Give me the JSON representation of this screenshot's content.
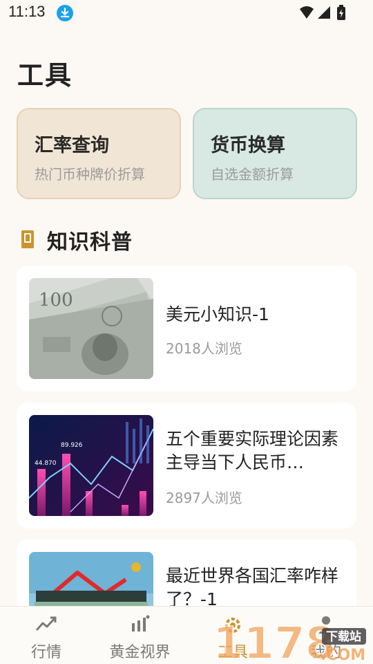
{
  "status": {
    "time": "11:13"
  },
  "page": {
    "title": "工具"
  },
  "tools": [
    {
      "title": "汇率查询",
      "subtitle": "热门币种牌价折算"
    },
    {
      "title": "货币换算",
      "subtitle": "自选金额折算"
    }
  ],
  "section": {
    "title": "知识科普",
    "icon": "book-icon"
  },
  "articles": [
    {
      "title": "美元小知识-1",
      "views": "2018人浏览",
      "image": "dollar-bills-photo"
    },
    {
      "title": "五个重要实际理论因素主导当下人民币…",
      "views": "2897人浏览",
      "image": "stock-chart-photo"
    },
    {
      "title": "最近世界各国汇率咋样了？-1",
      "views": "",
      "image": "currency-illustration"
    }
  ],
  "nav": [
    {
      "label": "行情",
      "icon": "trend-line-icon"
    },
    {
      "label": "黄金视界",
      "icon": "bar-chart-icon"
    },
    {
      "label": "工具",
      "icon": "gear-icon",
      "active": true
    },
    {
      "label": "我的",
      "icon": "person-icon"
    }
  ],
  "watermark": {
    "text": "1178",
    "subtext": "下载站",
    "domain": ".COM"
  },
  "colors": {
    "accent": "#c8952e",
    "rate_card": "#f1e5d5",
    "convert_card": "#d8e8e2",
    "background": "#fcf9f4"
  }
}
